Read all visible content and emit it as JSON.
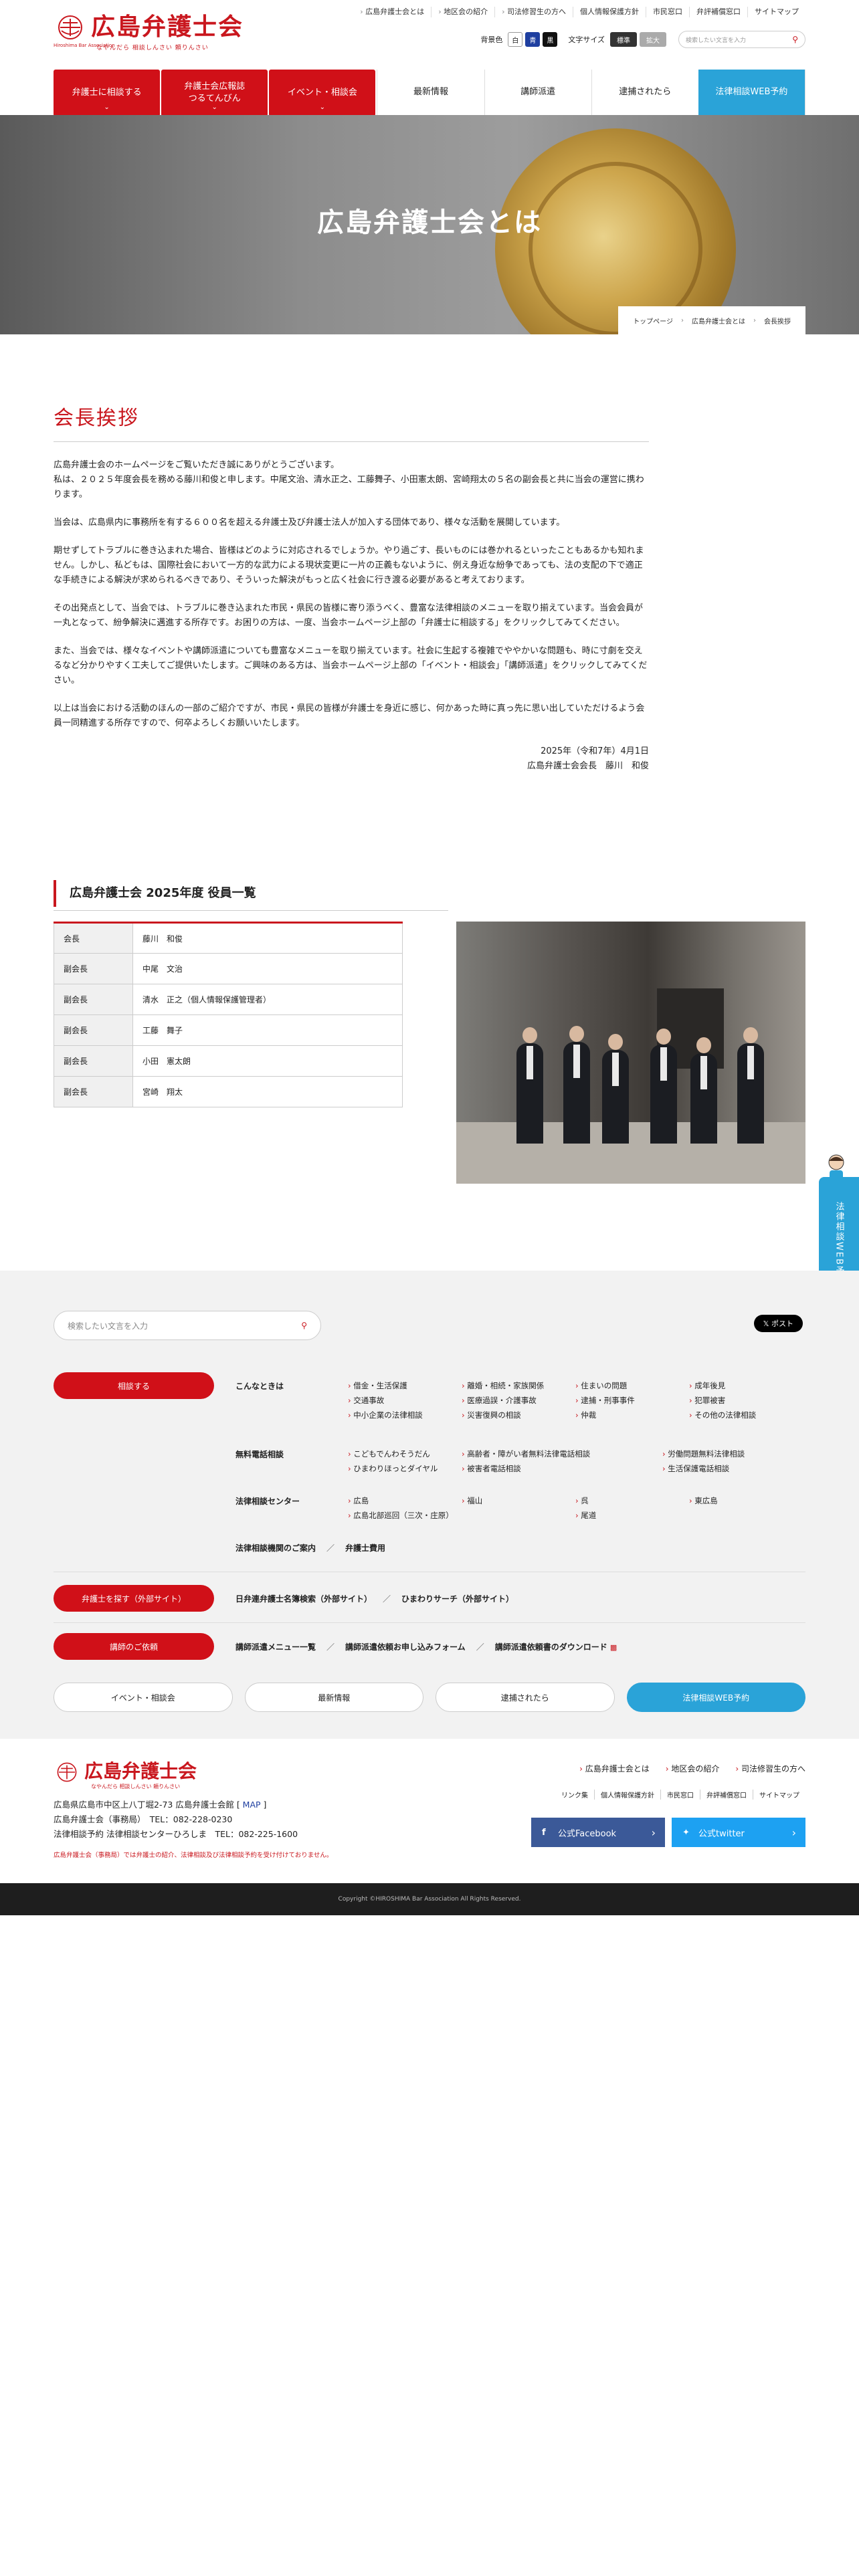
{
  "header": {
    "logo_text": "広島弁護士会",
    "logo_en": "Hiroshima Bar Association",
    "logo_tagline": "なやんだら 相談しんさい 頼りんさい",
    "top_links": [
      "広島弁護士会とは",
      "地区会の紹介",
      "司法修習生の方へ",
      "個人情報保護方針",
      "市民窓口",
      "弁評補償窓口",
      "サイトマップ"
    ],
    "bg_color_label": "背景色",
    "color_white": "白",
    "color_blue": "青",
    "color_black": "黒",
    "font_size_label": "文字サイズ",
    "size_normal": "標準",
    "size_large": "拡大",
    "search_placeholder": "検索したい文言を入力"
  },
  "nav": {
    "items": [
      {
        "label": "弁護士に相談する"
      },
      {
        "label": "弁護士会広報誌\nつるてんびん"
      },
      {
        "label": "イベント・相談会"
      },
      {
        "label": "最新情報"
      },
      {
        "label": "講師派遣"
      },
      {
        "label": "逮捕されたら"
      },
      {
        "label": "法律相談WEB予約"
      }
    ]
  },
  "hero": {
    "title": "広島弁護士会とは"
  },
  "breadcrumb": [
    "トップページ",
    "広島弁護士会とは",
    "会長挨拶"
  ],
  "greeting": {
    "title": "会長挨拶",
    "paragraphs": [
      "広島弁護士会のホームページをご覧いただき誠にありがとうございます。\n私は、２０２５年度会長を務める藤川和俊と申します。中尾文治、清水正之、工藤舞子、小田憲太朗、宮崎翔太の５名の副会長と共に当会の運営に携わります。",
      "当会は、広島県内に事務所を有する６００名を超える弁護士及び弁護士法人が加入する団体であり、様々な活動を展開しています。",
      "期せずしてトラブルに巻き込まれた場合、皆様はどのように対応されるでしょうか。やり過ごす、長いものには巻かれるといったこともあるかも知れません。しかし、私どもは、国際社会において一方的な武力による現状変更に一片の正義もないように、例え身近な紛争であっても、法の支配の下で適正な手続きによる解決が求められるべきであり、そういった解決がもっと広く社会に行き渡る必要があると考えております。",
      "その出発点として、当会では、トラブルに巻き込まれた市民・県民の皆様に寄り添うべく、豊富な法律相談のメニューを取り揃えています。当会会員が一丸となって、紛争解決に邁進する所存です。お困りの方は、一度、当会ホームページ上部の「弁護士に相談する」をクリックしてみてください。",
      "また、当会では、様々なイベントや講師派遣についても豊富なメニューを取り揃えています。社会に生起する複雑でややかいな問題も、時に寸劇を交えるなど分かりやすく工夫してご提供いたします。ご興味のある方は、当会ホームページ上部の「イベント・相談会」「講師派遣」をクリックしてみてください。",
      "以上は当会における活動のほんの一部のご紹介ですが、市民・県民の皆様が弁護士を身近に感じ、何かあった時に真っ先に思い出していただけるよう会員一同精進する所存ですので、何卒よろしくお願いいたします。"
    ],
    "date": "2025年（令和7年）4月1日",
    "signature": "広島弁護士会会長　藤川　和俊"
  },
  "officers": {
    "title": "広島弁護士会 2025年度 役員一覧",
    "rows": [
      {
        "role": "会長",
        "name": "藤川　和俊"
      },
      {
        "role": "副会長",
        "name": "中尾　文治"
      },
      {
        "role": "副会長",
        "name": "清水　正之（個人情報保護管理者）"
      },
      {
        "role": "副会長",
        "name": "工藤　舞子"
      },
      {
        "role": "副会長",
        "name": "小田　憲太朗"
      },
      {
        "role": "副会長",
        "name": "宮崎　翔太"
      }
    ]
  },
  "side_tab": {
    "label": "法律相談WEB予約"
  },
  "footer": {
    "search_placeholder": "検索したい文言を入力",
    "x_post": "ポスト",
    "consult_btn": "相談する",
    "cat_when": "こんなときは",
    "when_items": [
      "借金・生活保護",
      "離婚・相続・家族関係",
      "住まいの問題",
      "成年後見",
      "交通事故",
      "医療過誤・介護事故",
      "逮捕・刑事事件",
      "犯罪被害",
      "中小企業の法律相談",
      "災害復興の相談",
      "仲裁",
      "その他の法律相談"
    ],
    "cat_free": "無料電話相談",
    "free_items": [
      "こどもでんわそうだん",
      "高齢者・障がい者無料法律電話相談",
      "労働問題無料法律相談",
      "ひまわりほっとダイヤル",
      "被害者電話相談",
      "生活保護電話相談"
    ],
    "cat_center": "法律相談センター",
    "center_items": [
      "広島",
      "福山",
      "呉",
      "東広島",
      "広島北部巡回（三次・庄原）",
      "尾道"
    ],
    "center_more_1": "法律相談機関のご案内",
    "center_more_2": "弁護士費用",
    "find_btn": "弁護士を探す（外部サイト）",
    "find_1": "日弁連弁護士名簿検索（外部サイト）",
    "find_2": "ひまわりサーチ（外部サイト）",
    "lecture_btn": "講師のご依頼",
    "lecture_1": "講師派遣メニュー一覧",
    "lecture_2": "講師派遣依頼お申し込みフォーム",
    "lecture_3": "講師派遣依頼書のダウンロード",
    "pills": [
      "イベント・相談会",
      "最新情報",
      "逮捕されたら",
      "法律相談WEB予約"
    ],
    "address": "広島県広島市中区上八丁堀2-73 広島弁護士会館",
    "map": "MAP",
    "tel1": "広島弁護士会（事務局）　TEL：082-228-0230",
    "tel2": "法律相談予約 法律相談センターひろしま　TEL：082-225-1600",
    "note": "広島弁護士会（事務局）では弁護士の紹介、法律相談及び法律相談予約を受け付けておりません。",
    "links1": [
      "広島弁護士会とは",
      "地区会の紹介",
      "司法修習生の方へ"
    ],
    "links2": [
      "リンク集",
      "個人情報保護方針",
      "市民窓口",
      "弁評補償窓口",
      "サイトマップ"
    ],
    "facebook": "公式Facebook",
    "twitter": "公式twitter",
    "copyright": "Copyright ©HIROSHIMA Bar Association All Rights Reserved."
  },
  "colors": {
    "brand_red": "#c9171e",
    "accent_blue": "#2aa3d8"
  }
}
